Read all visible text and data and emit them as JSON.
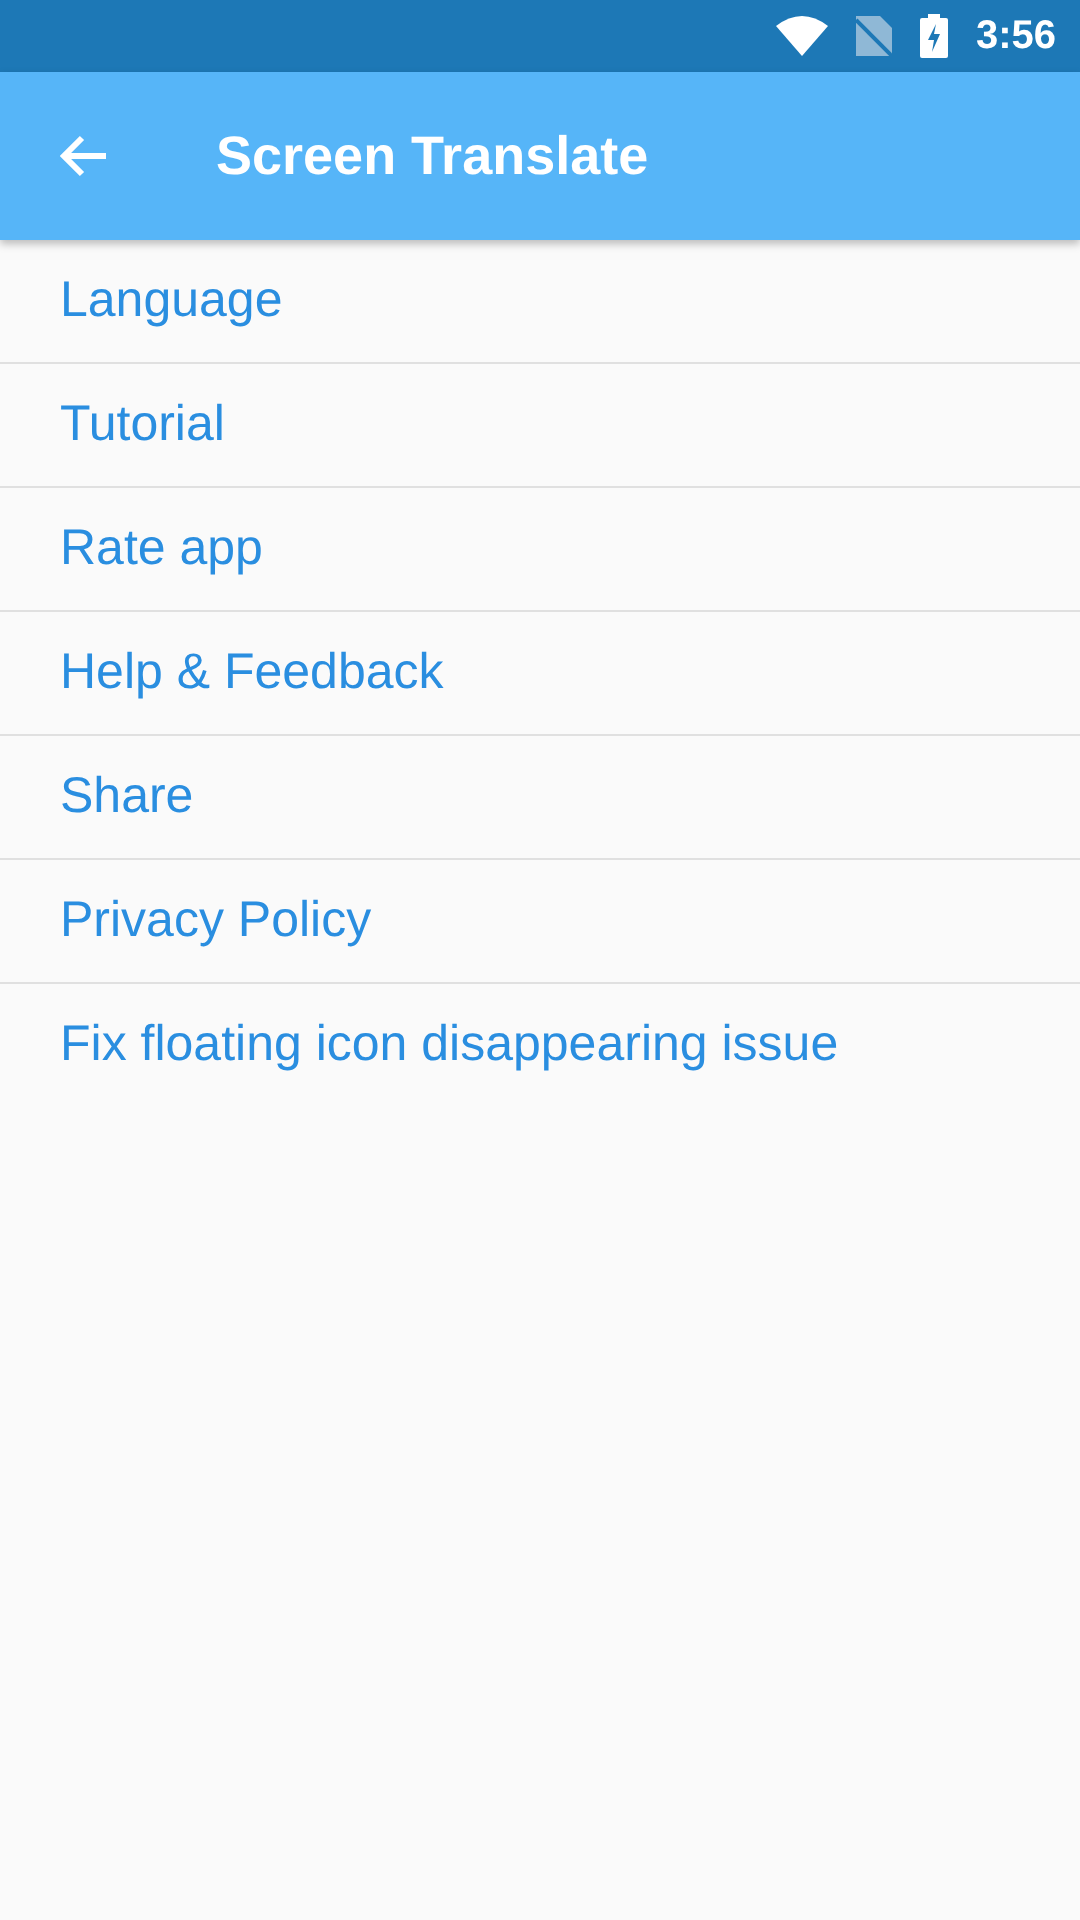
{
  "status_bar": {
    "time": "3:56"
  },
  "app_bar": {
    "title": "Screen Translate"
  },
  "menu": [
    {
      "label": "Language"
    },
    {
      "label": "Tutorial"
    },
    {
      "label": "Rate app"
    },
    {
      "label": "Help & Feedback"
    },
    {
      "label": "Share"
    },
    {
      "label": "Privacy Policy"
    },
    {
      "label": "Fix floating icon disappearing issue"
    }
  ]
}
